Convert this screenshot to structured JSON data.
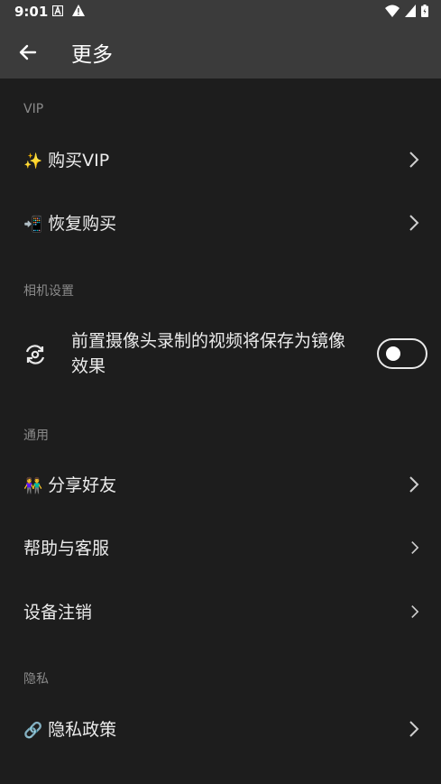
{
  "status": {
    "time": "9:01"
  },
  "header": {
    "title": "更多"
  },
  "sections": {
    "vip": "VIP",
    "camera": "相机设置",
    "general": "通用",
    "privacy": "隐私"
  },
  "items": {
    "buy_vip": {
      "emoji": "✨",
      "label": "购买VIP"
    },
    "restore": {
      "emoji": "📲",
      "label": "恢复购买"
    },
    "camera_mirror": {
      "label": "前置摄像头录制的视频将保存为镜像效果",
      "toggle_on": false
    },
    "share": {
      "emoji": "👫",
      "label": "分享好友"
    },
    "help": {
      "label": "帮助与客服"
    },
    "deregister": {
      "label": "设备注销"
    },
    "privacy_policy": {
      "emoji": "🔗",
      "label": "隐私政策"
    }
  }
}
